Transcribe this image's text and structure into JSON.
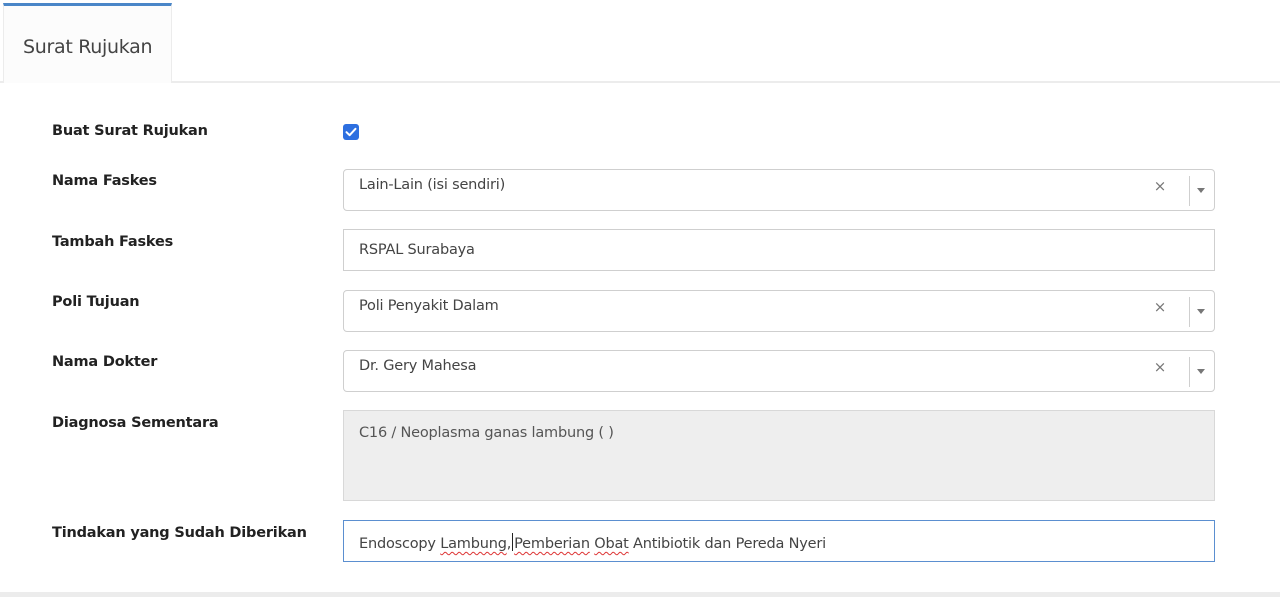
{
  "tabs": [
    {
      "label": "Surat Rujukan"
    }
  ],
  "form": {
    "buat_surat": {
      "label": "Buat Surat Rujukan",
      "checked": true
    },
    "nama_faskes": {
      "label": "Nama Faskes",
      "value": "Lain-Lain (isi sendiri)",
      "clear": "×"
    },
    "tambah_faskes": {
      "label": "Tambah Faskes",
      "value": "RSPAL Surabaya"
    },
    "poli_tujuan": {
      "label": "Poli Tujuan",
      "value": "Poli Penyakit Dalam",
      "clear": "×"
    },
    "nama_dokter": {
      "label": "Nama Dokter",
      "value": "Dr. Gery Mahesa",
      "clear": "×"
    },
    "diagnosa": {
      "label": "Diagnosa Sementara",
      "value": "C16 / Neoplasma ganas lambung (  )"
    },
    "tindakan": {
      "label": "Tindakan yang Sudah Diberikan",
      "value": "Endoscopy Lambung, Pemberian Obat Antibiotik dan Pereda Nyeri",
      "parts": [
        "Endoscopy ",
        "Lambung",
        ",",
        "Pemberian",
        " ",
        "Obat",
        " Antibiotik dan Pereda Nyeri"
      ]
    }
  },
  "colors": {
    "accent": "#4a86c8",
    "checkbox": "#2d6fe0",
    "readonly_bg": "#eeeeee"
  }
}
